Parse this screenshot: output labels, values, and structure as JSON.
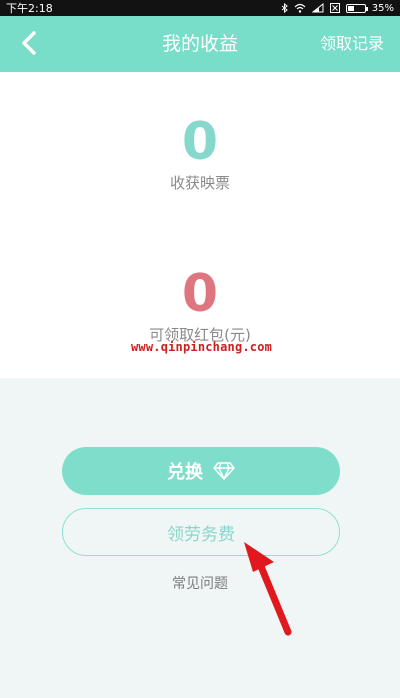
{
  "status_bar": {
    "time": "下午2:18",
    "battery": "35%",
    "battery_level": 0.35,
    "icons": [
      "bluetooth-icon",
      "wifi-icon",
      "signal-icon",
      "sim-icon",
      "battery-icon"
    ]
  },
  "header": {
    "back_icon": "chevron-left-icon",
    "title": "我的收益",
    "record_label": "领取记录"
  },
  "stats": {
    "tickets_value": "0",
    "tickets_label": "收获映票",
    "redpack_value": "0",
    "redpack_label": "可领取红包(元)"
  },
  "watermark": "www.qinpinchang.com",
  "actions": {
    "exchange_label": "兑换",
    "exchange_icon": "diamond-icon",
    "fee_label": "领劳务费",
    "faq_label": "常见问题"
  },
  "annotation": {
    "icon": "red-arrow-icon"
  },
  "colors": {
    "accent": "#78ddc9",
    "tickets_number": "#86d8cc",
    "redpack_number": "#de7680",
    "arrow": "#e0191e"
  }
}
